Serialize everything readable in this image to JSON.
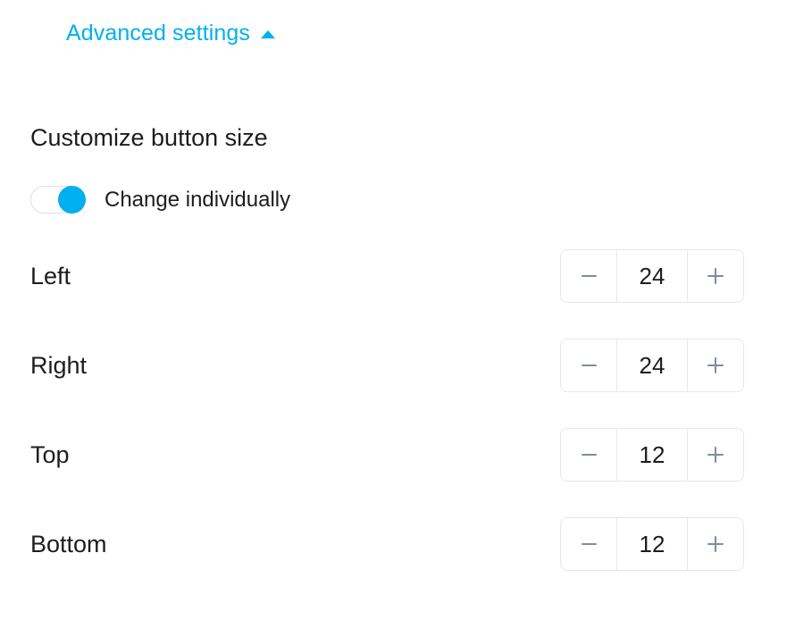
{
  "advanced_settings": {
    "label": "Advanced settings",
    "caret_icon": "caret-up-icon",
    "expanded": true,
    "accent_color": "#00b0f0"
  },
  "section": {
    "heading": "Customize button size"
  },
  "toggle": {
    "label": "Change individually",
    "state": "on",
    "on_color": "#00b0f0",
    "track_border_color": "#dcdfe3"
  },
  "size_rows": [
    {
      "label": "Left",
      "value": "24",
      "decrement_icon": "minus-icon",
      "increment_icon": "plus-icon"
    },
    {
      "label": "Right",
      "value": "24",
      "decrement_icon": "minus-icon",
      "increment_icon": "plus-icon"
    },
    {
      "label": "Top",
      "value": "12",
      "decrement_icon": "minus-icon",
      "increment_icon": "plus-icon"
    },
    {
      "label": "Bottom",
      "value": "12",
      "decrement_icon": "minus-icon",
      "increment_icon": "plus-icon"
    }
  ],
  "colors": {
    "accent": "#00b0f0",
    "text": "#1d1d1d",
    "border": "#e6e8ea",
    "glyph": "#7e8d9b",
    "background": "#ffffff"
  }
}
